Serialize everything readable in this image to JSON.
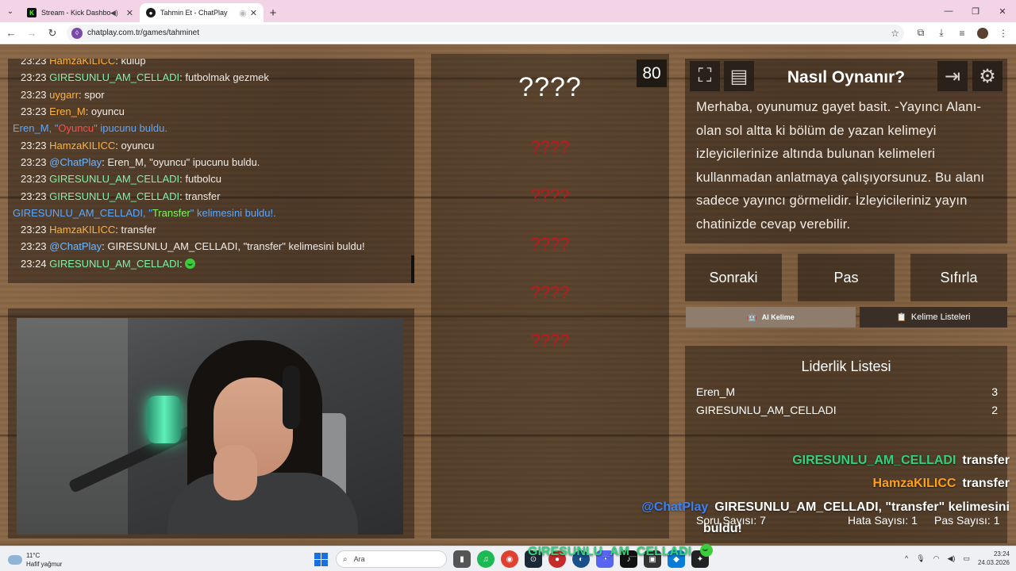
{
  "browser": {
    "tabs": [
      {
        "label": "Stream - Kick Dashboard",
        "active": false
      },
      {
        "label": "Tahmin Et - ChatPlay",
        "active": true
      }
    ],
    "url": "chatplay.com.tr/games/tahminet"
  },
  "chat": {
    "lines": [
      {
        "time": "23:23",
        "user": "HamzaKILICC",
        "color": "orange",
        "text": ": kulüp"
      },
      {
        "time": "23:23",
        "user": "GIRESUNLU_AM_CELLADI",
        "color": "green",
        "text": ": futbolmak gezmek"
      },
      {
        "time": "23:23",
        "user": "uygarr",
        "color": "orange",
        "text": ": spor"
      },
      {
        "time": "23:23",
        "user": "Eren_M",
        "color": "orange",
        "text": ": oyuncu"
      },
      {
        "system": true,
        "pre": "Eren_M, \"",
        "word": "Oyuncu",
        "post": "\" ipucunu buldu."
      },
      {
        "time": "23:23",
        "user": "HamzaKILICC",
        "color": "orange",
        "text": ": oyuncu"
      },
      {
        "time": "23:23",
        "user": "@ChatPlay",
        "color": "blue",
        "text": ": Eren_M, \"oyuncu\" ipucunu buldu."
      },
      {
        "time": "23:23",
        "user": "GIRESUNLU_AM_CELLADI",
        "color": "green",
        "text": ": futbolcu"
      },
      {
        "time": "23:23",
        "user": "GIRESUNLU_AM_CELLADI",
        "color": "green",
        "text": ": transfer"
      },
      {
        "system": true,
        "pre": "GIRESUNLU_AM_CELLADI, \"",
        "word": "Transfer",
        "post": "\" kelimesini buldu!."
      },
      {
        "time": "23:23",
        "user": "HamzaKILICC",
        "color": "orange",
        "text": ": transfer"
      },
      {
        "time": "23:23",
        "user": "@ChatPlay",
        "color": "blue",
        "text": ": GIRESUNLU_AM_CELLADI, \"transfer\" kelimesini buldu!"
      },
      {
        "time": "23:24",
        "user": "GIRESUNLU_AM_CELLADI",
        "color": "green",
        "text": ": ",
        "emote": true
      }
    ]
  },
  "game": {
    "score": "80",
    "main_word": "????",
    "hints": [
      "????",
      "????",
      "????",
      "????",
      "????"
    ]
  },
  "howto": {
    "title": "Nasıl Oynanır?",
    "text": "Merhaba, oyunumuz gayet basit. -Yayıncı Alanı- olan sol altta ki bölüm de yazan kelimeyi izleyicilerinize altında bulunan kelimeleri kullanmadan anlatmaya çalışıyorsunuz. Bu alanı sadece yayıncı görmelidir. İzleyicileriniz yayın chatinizde cevap verebilir."
  },
  "buttons": {
    "next": "Sonraki",
    "pass": "Pas",
    "reset": "Sıfırla",
    "ai_word": "AI Kelime",
    "word_lists": "Kelime Listeleri"
  },
  "leaderboard": {
    "title": "Liderlik Listesi",
    "rows": [
      {
        "name": "Eren_M",
        "score": "3"
      },
      {
        "name": "GIRESUNLU_AM_CELLADI",
        "score": "2"
      }
    ]
  },
  "overlay_chat": [
    {
      "user": "GIRESUNLU_AM_CELLADI",
      "color": "#33d17a",
      "text": "transfer"
    },
    {
      "user": "HamzaKILICC",
      "color": "#ff9f1a",
      "text": "transfer"
    },
    {
      "user": "@ChatPlay",
      "color": "#3b82f6",
      "text": "GIRESUNLU_AM_CELLADI, \"transfer\" kelimesini"
    },
    {
      "user": "",
      "color": "#ffffff",
      "text": "buldu!"
    },
    {
      "user": "GIRESUNLU_AM_CELLADI",
      "color": "#33d17a",
      "text": ""
    }
  ],
  "stats": {
    "questions": "Soru Sayısı: 7",
    "errors": "Hata Sayısı: 1",
    "passes": "Pas Sayısı: 1"
  },
  "taskbar": {
    "weather_temp": "11°C",
    "weather_desc": "Hafif yağmur",
    "search": "Ara",
    "time": "23:24",
    "date": "24.03.2026"
  },
  "colors": {
    "hint_red": "#c4161c",
    "panel": "rgba(20,14,10,0.45)"
  }
}
